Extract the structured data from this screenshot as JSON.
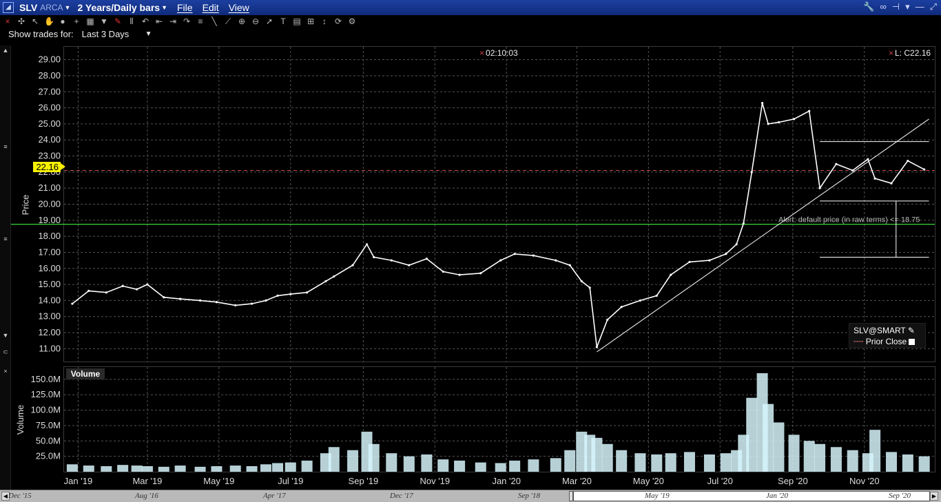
{
  "titlebar": {
    "logo": "◢",
    "symbol": "SLV",
    "exchange": "ARCA",
    "period": "2 Years/Daily bars",
    "menus": [
      "File",
      "Edit",
      "View"
    ]
  },
  "trades": {
    "label": "Show trades for:",
    "value": "Last 3 Days"
  },
  "price_panel": {
    "axis_label": "Price",
    "time_note": "02:10:03",
    "last_label": "L: C22.16",
    "current_price_tag": "22.16",
    "alert_text": "Alert: default price (in raw terms) <= 18.75",
    "alert_value": "18.75"
  },
  "legend": {
    "title": "SLV@SMART",
    "prior_close": "Prior Close"
  },
  "volume_panel": {
    "header": "Volume",
    "axis_label": "Volume"
  },
  "navigator": {
    "ticks": [
      "Dec '15",
      "Aug '16",
      "Apr '17",
      "Dec '17",
      "Sep '18",
      "May '19",
      "Jan '20",
      "Sep '20"
    ]
  },
  "colors": {
    "background": "#000000",
    "price_series": "#ffffff",
    "volume_bars": "#d6f4fb",
    "alert_line": "#39c639",
    "prior_close": "#d05050",
    "price_tag": "#f5f000",
    "titlebar": "#14358f"
  },
  "chart_data": [
    {
      "type": "ohlc",
      "title": "",
      "ylabel": "Price",
      "ylim": [
        10.2,
        29.8
      ],
      "yticks": [
        "11.00",
        "12.00",
        "13.00",
        "14.00",
        "15.00",
        "16.00",
        "17.00",
        "18.00",
        "19.00",
        "20.00",
        "21.00",
        "22.00",
        "23.00",
        "24.00",
        "25.00",
        "26.00",
        "27.00",
        "28.00",
        "29.00"
      ],
      "grid": true,
      "x": [
        "2018-12-27",
        "2019-01-10",
        "2019-01-25",
        "2019-02-08",
        "2019-02-20",
        "2019-03-01",
        "2019-03-15",
        "2019-03-29",
        "2019-04-15",
        "2019-04-29",
        "2019-05-15",
        "2019-05-29",
        "2019-06-10",
        "2019-06-20",
        "2019-07-01",
        "2019-07-15",
        "2019-07-31",
        "2019-08-07",
        "2019-08-23",
        "2019-09-04",
        "2019-09-10",
        "2019-09-25",
        "2019-10-10",
        "2019-10-25",
        "2019-11-08",
        "2019-11-22",
        "2019-12-10",
        "2019-12-27",
        "2020-01-08",
        "2020-01-24",
        "2020-02-12",
        "2020-02-24",
        "2020-03-05",
        "2020-03-12",
        "2020-03-18",
        "2020-03-27",
        "2020-04-08",
        "2020-04-24",
        "2020-05-08",
        "2020-05-20",
        "2020-06-05",
        "2020-06-22",
        "2020-07-06",
        "2020-07-15",
        "2020-07-21",
        "2020-07-28",
        "2020-08-06",
        "2020-08-11",
        "2020-08-20",
        "2020-09-02",
        "2020-09-15",
        "2020-09-24",
        "2020-10-08",
        "2020-10-22",
        "2020-11-04",
        "2020-11-10",
        "2020-11-24",
        "2020-12-08",
        "2020-12-22"
      ],
      "close": [
        13.8,
        14.6,
        14.5,
        14.9,
        14.7,
        15.0,
        14.2,
        14.1,
        14.0,
        13.9,
        13.7,
        13.8,
        14.0,
        14.3,
        14.4,
        14.5,
        15.2,
        15.5,
        16.2,
        17.5,
        16.7,
        16.5,
        16.2,
        16.6,
        15.8,
        15.6,
        15.7,
        16.5,
        16.9,
        16.8,
        16.5,
        16.2,
        15.2,
        14.8,
        11.1,
        12.8,
        13.6,
        14.0,
        14.3,
        15.6,
        16.4,
        16.5,
        16.9,
        17.5,
        18.8,
        22.0,
        26.3,
        25.0,
        25.1,
        25.3,
        25.8,
        21.0,
        22.5,
        22.1,
        22.8,
        21.6,
        21.3,
        22.7,
        22.16
      ],
      "series": [
        {
          "name": "SLV",
          "values": [
            13.8,
            14.6,
            14.5,
            14.9,
            14.7,
            15.0,
            14.2,
            14.1,
            14.0,
            13.9,
            13.7,
            13.8,
            14.0,
            14.3,
            14.4,
            14.5,
            15.2,
            15.5,
            16.2,
            17.5,
            16.7,
            16.5,
            16.2,
            16.6,
            15.8,
            15.6,
            15.7,
            16.5,
            16.9,
            16.8,
            16.5,
            16.2,
            15.2,
            14.8,
            11.1,
            12.8,
            13.6,
            14.0,
            14.3,
            15.6,
            16.4,
            16.5,
            16.9,
            17.5,
            18.8,
            22.0,
            26.3,
            25.0,
            25.1,
            25.3,
            25.8,
            21.0,
            22.5,
            22.1,
            22.8,
            21.6,
            21.3,
            22.7,
            22.16
          ]
        }
      ],
      "last": 22.16,
      "prior_close": 22.1,
      "alert_level": 18.75,
      "annotations": [
        "02:10:03",
        "L: C22.16"
      ]
    },
    {
      "type": "bar",
      "title": "Volume",
      "ylabel": "Volume",
      "ylim": [
        0,
        170
      ],
      "yticks": [
        "25.0M",
        "50.0M",
        "75.0M",
        "100.0M",
        "125.0M",
        "150.0M"
      ],
      "grid": true,
      "x": [
        "2018-12-27",
        "2019-01-10",
        "2019-01-25",
        "2019-02-08",
        "2019-02-20",
        "2019-03-01",
        "2019-03-15",
        "2019-03-29",
        "2019-04-15",
        "2019-04-29",
        "2019-05-15",
        "2019-05-29",
        "2019-06-10",
        "2019-06-20",
        "2019-07-01",
        "2019-07-15",
        "2019-07-31",
        "2019-08-07",
        "2019-08-23",
        "2019-09-04",
        "2019-09-10",
        "2019-09-25",
        "2019-10-10",
        "2019-10-25",
        "2019-11-08",
        "2019-11-22",
        "2019-12-10",
        "2019-12-27",
        "2020-01-08",
        "2020-01-24",
        "2020-02-12",
        "2020-02-24",
        "2020-03-05",
        "2020-03-12",
        "2020-03-18",
        "2020-03-27",
        "2020-04-08",
        "2020-04-24",
        "2020-05-08",
        "2020-05-20",
        "2020-06-05",
        "2020-06-22",
        "2020-07-06",
        "2020-07-15",
        "2020-07-21",
        "2020-07-28",
        "2020-08-06",
        "2020-08-11",
        "2020-08-20",
        "2020-09-02",
        "2020-09-15",
        "2020-09-24",
        "2020-10-08",
        "2020-10-22",
        "2020-11-04",
        "2020-11-10",
        "2020-11-24",
        "2020-12-08",
        "2020-12-22"
      ],
      "values": [
        12,
        10,
        9,
        11,
        10,
        9,
        8,
        10,
        8,
        9,
        10,
        9,
        12,
        14,
        15,
        18,
        30,
        40,
        35,
        65,
        45,
        30,
        25,
        28,
        20,
        18,
        15,
        14,
        18,
        20,
        22,
        35,
        65,
        60,
        55,
        45,
        35,
        30,
        28,
        30,
        32,
        28,
        30,
        35,
        60,
        120,
        160,
        110,
        80,
        60,
        50,
        45,
        40,
        35,
        30,
        68,
        32,
        28,
        25
      ],
      "series": [
        {
          "name": "Volume",
          "values": [
            12,
            10,
            9,
            11,
            10,
            9,
            8,
            10,
            8,
            9,
            10,
            9,
            12,
            14,
            15,
            18,
            30,
            40,
            35,
            65,
            45,
            30,
            25,
            28,
            20,
            18,
            15,
            14,
            18,
            20,
            22,
            35,
            65,
            60,
            55,
            45,
            35,
            30,
            28,
            30,
            32,
            28,
            30,
            35,
            60,
            120,
            160,
            110,
            80,
            60,
            50,
            45,
            40,
            35,
            30,
            68,
            32,
            28,
            25
          ]
        }
      ],
      "units": "M"
    }
  ],
  "xaxis_ticks": [
    "Jan '19",
    "Mar '19",
    "May '19",
    "Jul '19",
    "Sep '19",
    "Nov '19",
    "Jan '20",
    "Mar '20",
    "May '20",
    "Jul '20",
    "Sep '20",
    "Nov '20"
  ]
}
